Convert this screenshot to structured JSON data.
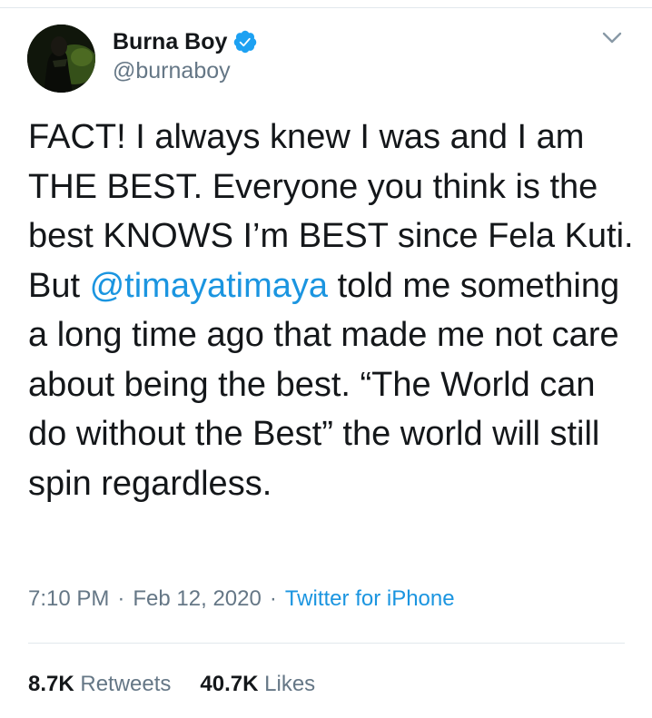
{
  "author": {
    "name": "Burna Boy",
    "handle": "@burnaboy",
    "verified": true,
    "verified_icon": "verified-badge-icon",
    "avatar_icon": "avatar-photo"
  },
  "menu": {
    "icon": "chevron-down-icon"
  },
  "tweet": {
    "text_part1": "FACT! I always knew I was and I am THE BEST. Everyone you think is the best KNOWS I’m BEST since Fela Kuti. But ",
    "mention": "@timayatimaya",
    "text_part2": " told me something a long time ago that made me not care about being the best. “The World can do without the Best” the world will still spin regardless."
  },
  "meta": {
    "time": "7:10 PM",
    "date": "Feb 12, 2020",
    "separator": "·",
    "source": "Twitter for iPhone"
  },
  "stats": {
    "retweets_count": "8.7K",
    "retweets_label": "Retweets",
    "likes_count": "40.7K",
    "likes_label": "Likes"
  },
  "colors": {
    "text": "#14171a",
    "secondary": "#657786",
    "link": "#1b95e0",
    "verified": "#1da1f2",
    "divider": "#e1e8ed"
  }
}
